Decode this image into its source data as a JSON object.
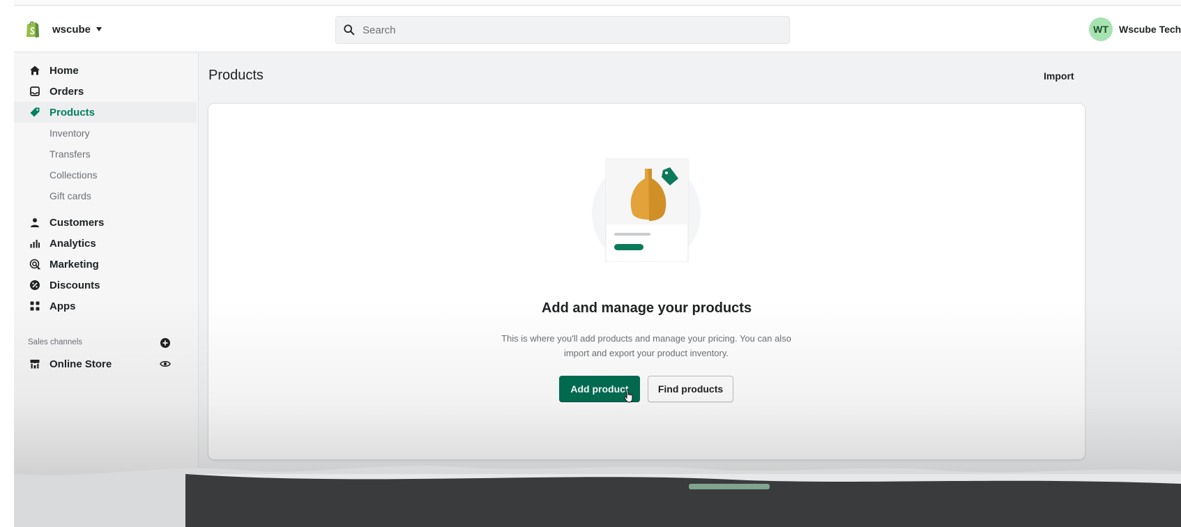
{
  "topbar": {
    "store_name": "wscube",
    "search_placeholder": "Search",
    "user_initials": "WT",
    "user_name": "Wscube Tech"
  },
  "sidebar": {
    "items": [
      {
        "label": "Home",
        "icon": "home-icon"
      },
      {
        "label": "Orders",
        "icon": "orders-icon"
      },
      {
        "label": "Products",
        "icon": "tag-icon",
        "active": true
      },
      {
        "label": "Customers",
        "icon": "person-icon"
      },
      {
        "label": "Analytics",
        "icon": "bar-chart-icon"
      },
      {
        "label": "Marketing",
        "icon": "target-icon"
      },
      {
        "label": "Discounts",
        "icon": "discount-icon"
      },
      {
        "label": "Apps",
        "icon": "apps-icon"
      }
    ],
    "product_subitems": [
      "Inventory",
      "Transfers",
      "Collections",
      "Gift cards"
    ],
    "sales_channels_label": "Sales channels",
    "channels": [
      {
        "label": "Online Store",
        "icon": "store-icon",
        "action_icon": "eye-icon"
      }
    ],
    "add_channel_icon": "plus-circle-icon"
  },
  "page": {
    "title": "Products",
    "import_label": "Import"
  },
  "empty_state": {
    "title": "Add and manage your products",
    "description": "This is where you'll add products and manage your pricing. You can also import and export your product inventory.",
    "primary_action": "Add product",
    "secondary_action": "Find products"
  },
  "colors": {
    "brand_green": "#008060",
    "primary_button": "#006e52",
    "avatar_bg": "#a6e3b0",
    "vase": "#e3a33a"
  }
}
